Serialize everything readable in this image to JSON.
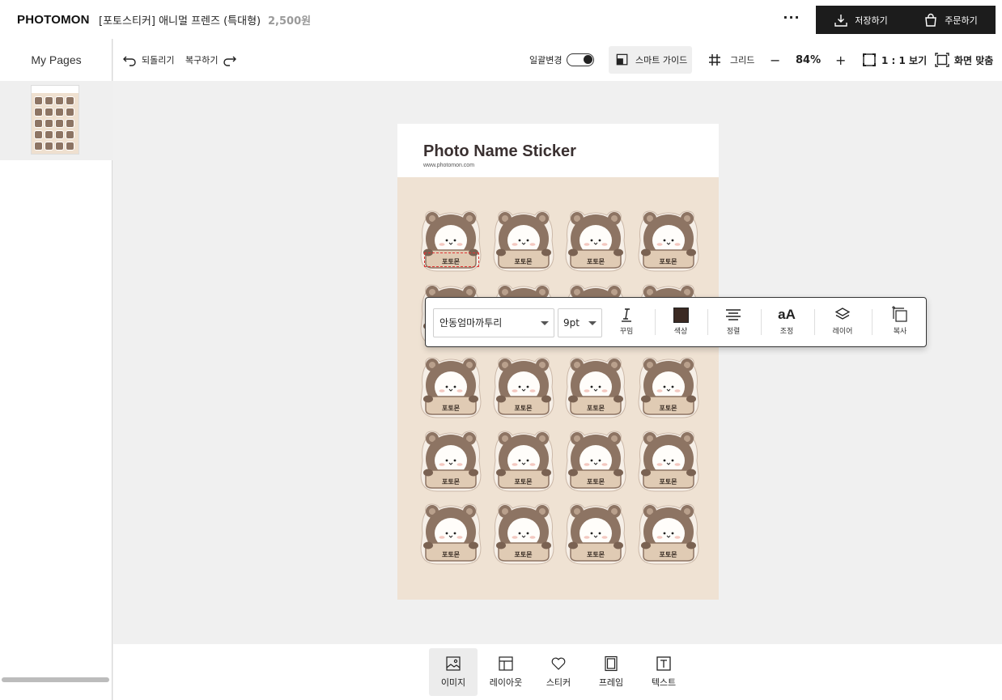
{
  "header": {
    "logo": "PHOTOMON",
    "title": "[포토스티커] 애니멀 프렌즈 (특대형)",
    "price": "2,500원",
    "more_label": "···",
    "save_label": "저장하기",
    "order_label": "주문하기"
  },
  "toolbar": {
    "undo_label": "되돌리기",
    "redo_label": "복구하기",
    "batch_change_label": "일괄변경",
    "batch_change_on": true,
    "smart_guide_label": "스마트 가이드",
    "grid_label": "그리드",
    "zoom_minus": "−",
    "zoom_value": "84%",
    "zoom_plus": "+",
    "actual_size_label": "1 : 1 보기",
    "fit_screen_label": "화면 맞춤"
  },
  "left_panel": {
    "title": "My Pages"
  },
  "canvas": {
    "page_title": "Photo Name Sticker",
    "page_url": "www.photomon.com",
    "sticker_label": "포토몬",
    "sticker_rows": 5,
    "sticker_cols": 4
  },
  "text_toolbar": {
    "font_name": "안동엄마까투리",
    "font_size": "9pt",
    "decoration_label": "꾸밈",
    "color_label": "색상",
    "color_value": "#3b2a23",
    "align_label": "정렬",
    "adjust_label": "조정",
    "adjust_icon_text": "aA",
    "layer_label": "레이어",
    "copy_label": "복사"
  },
  "bottom_tools": [
    {
      "label": "이미지",
      "icon": "image-icon",
      "active": true
    },
    {
      "label": "레이아웃",
      "icon": "layout-icon",
      "active": false
    },
    {
      "label": "스티커",
      "icon": "heart-icon",
      "active": false
    },
    {
      "label": "프레임",
      "icon": "frame-icon",
      "active": false
    },
    {
      "label": "텍스트",
      "icon": "text-icon",
      "active": false
    }
  ],
  "colors": {
    "accent_dark": "#1c1c1c",
    "sticker_brown": "#8d7463",
    "page_bg": "#efe2d3"
  }
}
